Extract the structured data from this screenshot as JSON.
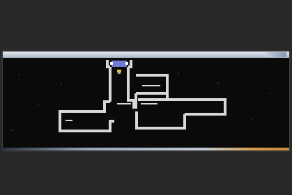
{
  "window": {
    "title": "",
    "has_status_bar": true
  },
  "map": {
    "description_icons": [
      "stairs-icon",
      "player-icon"
    ],
    "colors": {
      "wall": "#d8d8d8",
      "floor": "#0a0a0a",
      "player": "#e0c040",
      "stairs": "#6d7bd0",
      "highlight": "#ffffff"
    }
  }
}
